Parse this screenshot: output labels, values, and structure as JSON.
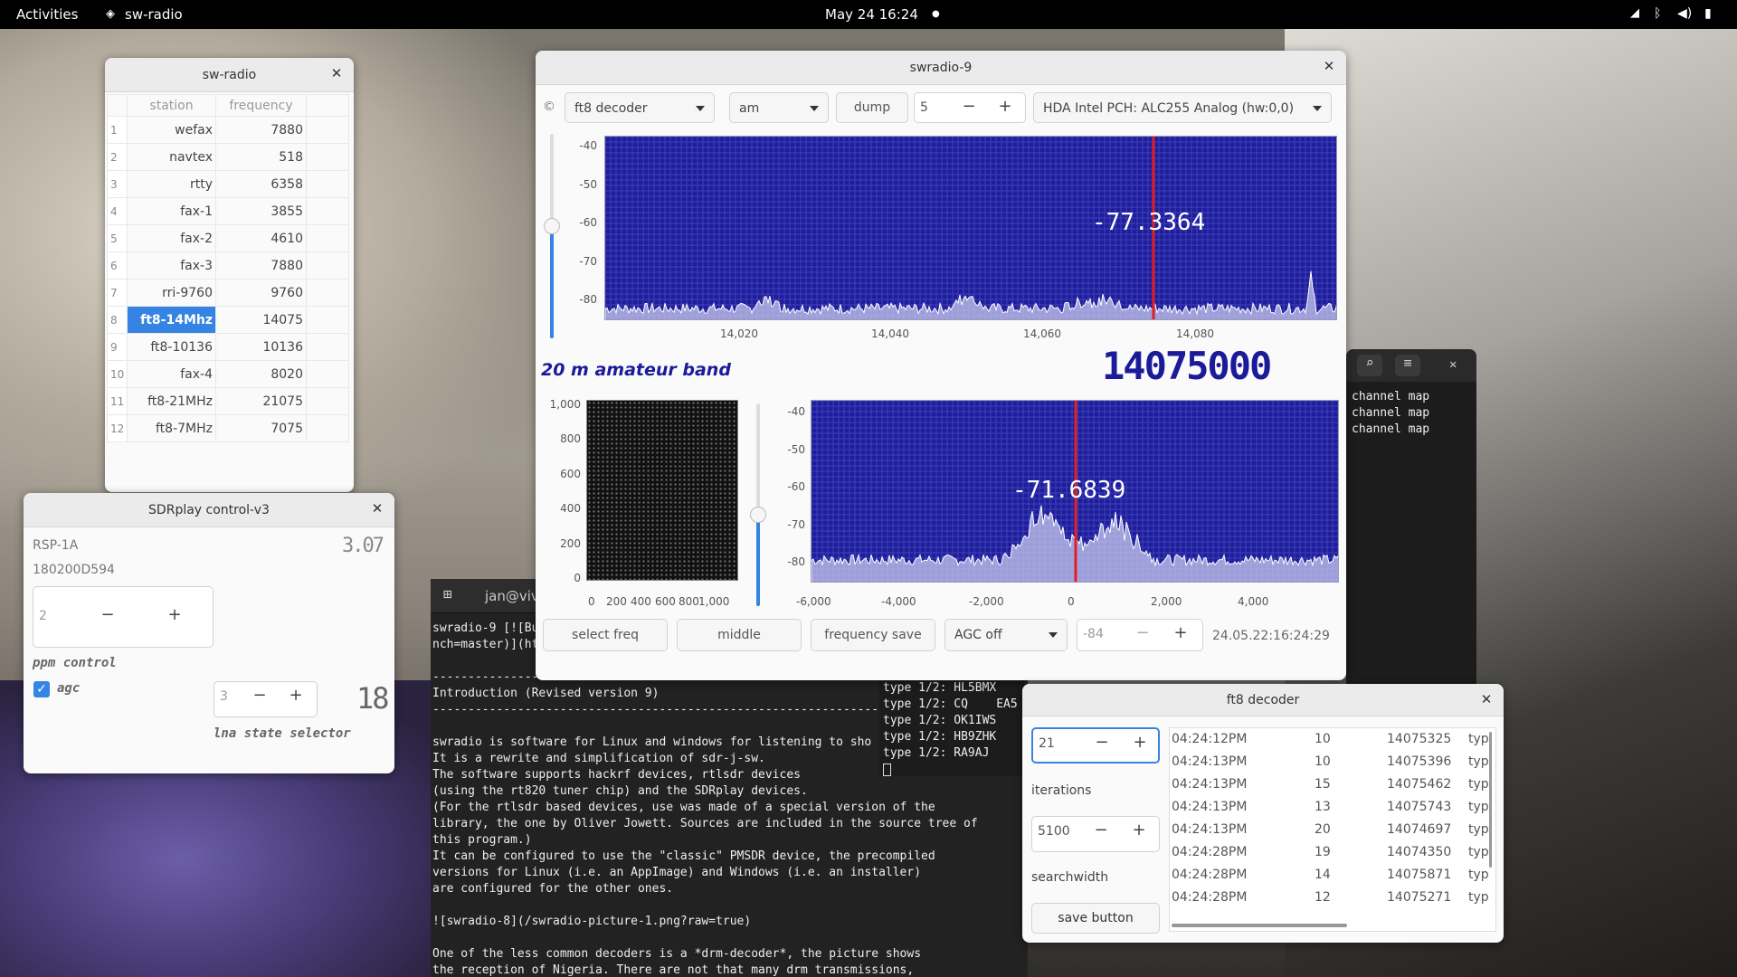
{
  "topbar": {
    "activities": "Activities",
    "app": "sw-radio",
    "clock": "May 24  16:24"
  },
  "swradio_list": {
    "title": "sw-radio",
    "col_station": "station",
    "col_frequency": "frequency",
    "rows": [
      {
        "n": "1",
        "station": "wefax",
        "freq": "7880"
      },
      {
        "n": "2",
        "station": "navtex",
        "freq": "518"
      },
      {
        "n": "3",
        "station": "rtty",
        "freq": "6358"
      },
      {
        "n": "4",
        "station": "fax-1",
        "freq": "3855"
      },
      {
        "n": "5",
        "station": "fax-2",
        "freq": "4610"
      },
      {
        "n": "6",
        "station": "fax-3",
        "freq": "7880"
      },
      {
        "n": "7",
        "station": "rri-9760",
        "freq": "9760"
      },
      {
        "n": "8",
        "station": "ft8-14Mhz",
        "freq": "14075"
      },
      {
        "n": "9",
        "station": "ft8-10136",
        "freq": "10136"
      },
      {
        "n": "10",
        "station": "fax-4",
        "freq": "8020"
      },
      {
        "n": "11",
        "station": "ft8-21MHz",
        "freq": "21075"
      },
      {
        "n": "12",
        "station": "ft8-7MHz",
        "freq": "7075"
      }
    ],
    "selected_row": 8
  },
  "sdrplay": {
    "title": "SDRplay control-v3",
    "device": "RSP-1A",
    "serial": "180200D594",
    "version": "3.07",
    "ppm_value": "2",
    "ppm_label": "ppm control",
    "agc_label": "agc",
    "agc_checked": true,
    "lna_value": "3",
    "lna_display": "18",
    "lna_label": "lna state selector"
  },
  "main": {
    "title": "swradio-9",
    "decoder": "ft8 decoder",
    "mode": "am",
    "dump": "dump",
    "spin_value": "5",
    "device": "HDA Intel PCH: ALC255 Analog (hw:0,0)",
    "band_label": "20 m amateur band",
    "freq_display": "14075000",
    "top_scope": {
      "readout": "-77.3364",
      "y_ticks": [
        "-40",
        "-50",
        "-60",
        "-70",
        "-80"
      ],
      "x_ticks": [
        "14,020",
        "14,040",
        "14,060",
        "14,080"
      ],
      "slider_level": 0.55
    },
    "iq_scope": {
      "y_ticks": [
        "1,000",
        "800",
        "600",
        "400",
        "200",
        "0"
      ],
      "x_ticks": [
        "0",
        "200",
        "400",
        "600",
        "800",
        "1,000"
      ]
    },
    "bottom_scope": {
      "readout": "-71.6839",
      "y_ticks": [
        "-40",
        "-50",
        "-60",
        "-70",
        "-80"
      ],
      "x_ticks": [
        "-6,000",
        "-4,000",
        "-2,000",
        "0",
        "2,000",
        "4,000"
      ],
      "slider_level": 0.45
    },
    "buttons": {
      "select_freq": "select freq",
      "middle": "middle",
      "frequency_save": "frequency save"
    },
    "agc": "AGC off",
    "agc_value": "-84",
    "timestamp": "24.05.22:16:24:29"
  },
  "terminal": {
    "tab": "jan@viv",
    "lines": [
      "swradio-9 [![Build Status](https://travis-ci.org/JvanKatwijk/swradio-8.svg?bra",
      "nch=master)](ht",
      "",
      "--------------------------------------------------------------------------------",
      "Introduction (Revised version 9)",
      "--------------------------------------------------------------------------------",
      "",
      "swradio is software for Linux and windows for listening to sho",
      "It is a rewrite and simplification of sdr-j-sw.",
      "The software supports hackrf devices, rtlsdr devices",
      "(using the rt820 tuner chip) and the SDRplay devices.",
      "(For the rtlsdr based devices, use was made of a special version of the",
      "library, the one by Oliver Jowett. Sources are included in the source tree of",
      "this program.)",
      "It can be configured to use the \"classic\" PMSDR device, the precompiled",
      "versions for Linux (i.e. an AppImage) and Windows (i.e. an installer)",
      "are configured for the other ones.",
      "",
      "![swradio-8](/swradio-picture-1.png?raw=true)",
      "",
      "One of the less common decoders is a *drm-decoder*, the picture shows",
      "the reception of Nigeria. There are not that many drm transmissions,"
    ]
  },
  "ft8_messages": [
    "type 1/2: HL5BMX",
    "type 1/2: CQ    EA5",
    "type 1/2: OK1IWS",
    "type 1/2: HB9ZHK",
    "type 1/2: RA9AJ"
  ],
  "channel_map": {
    "lines": [
      "channel map",
      "channel map",
      "channel map"
    ]
  },
  "ft8": {
    "title": "ft8 decoder",
    "iter_value": "21",
    "iter_label": "iterations",
    "search_value": "5100",
    "search_label": "searchwidth",
    "save": "save button",
    "rows": [
      {
        "time": "04:24:12PM",
        "snr": "10",
        "freq": "14075325",
        "t": "typ"
      },
      {
        "time": "04:24:13PM",
        "snr": "10",
        "freq": "14075396",
        "t": "typ"
      },
      {
        "time": "04:24:13PM",
        "snr": "15",
        "freq": "14075462",
        "t": "typ"
      },
      {
        "time": "04:24:13PM",
        "snr": "13",
        "freq": "14075743",
        "t": "typ"
      },
      {
        "time": "04:24:13PM",
        "snr": "20",
        "freq": "14074697",
        "t": "typ"
      },
      {
        "time": "04:24:28PM",
        "snr": "19",
        "freq": "14074350",
        "t": "typ"
      },
      {
        "time": "04:24:28PM",
        "snr": "14",
        "freq": "14075871",
        "t": "typ"
      },
      {
        "time": "04:24:28PM",
        "snr": "12",
        "freq": "14075271",
        "t": "typ"
      }
    ]
  },
  "colors": {
    "scope_bg": "#1e1e9c",
    "marker": "#e02020",
    "selected": "#3584e4",
    "lcd": "#1b1b9a"
  }
}
